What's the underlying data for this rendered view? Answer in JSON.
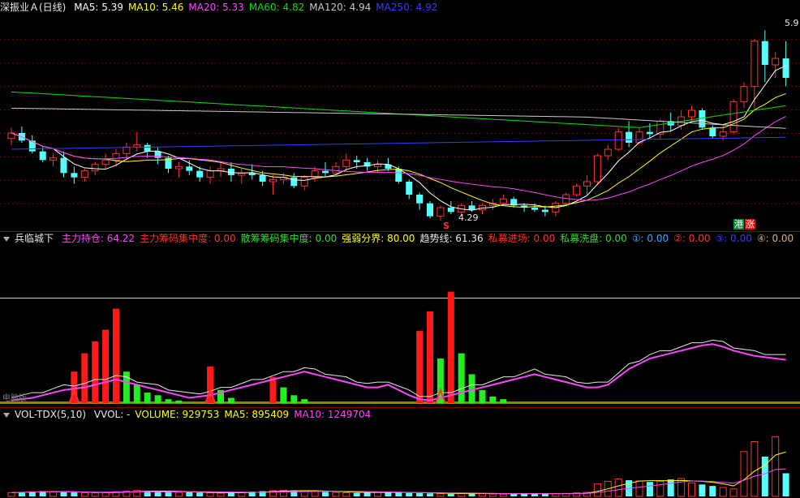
{
  "main": {
    "title": "深振业Ａ(日线)",
    "ma": [
      {
        "label": "MA5: 5.39",
        "color": "#ffffff"
      },
      {
        "label": "MA10: 5.46",
        "color": "#ffff00"
      },
      {
        "label": "MA20: 5.33",
        "color": "#ff44ff"
      },
      {
        "label": "MA60: 4.82",
        "color": "#00e000"
      },
      {
        "label": "MA120: 4.94",
        "color": "#c8c8c8"
      },
      {
        "label": "MA250: 4.92",
        "color": "#3a3aff"
      }
    ],
    "high_label": "5.9",
    "low_label": "4.29",
    "signal_s": "S",
    "badge_left": "港",
    "badge_right": "涨"
  },
  "indicator": {
    "name": "兵临城下",
    "items": [
      {
        "label": "主力持仓: 64.22",
        "color": "#ff44ff"
      },
      {
        "label": "主力筹码集中度: 0.00",
        "color": "#ff3030"
      },
      {
        "label": "散筹筹码集中度: 0.00",
        "color": "#33dd33"
      },
      {
        "label": "强弱分界: 80.00",
        "color": "#ffff00"
      },
      {
        "label": "趋势线: 61.36",
        "color": "#e8e8e8"
      },
      {
        "label": "私募进场: 0.00",
        "color": "#ff3030"
      },
      {
        "label": "私募洗盘: 0.00",
        "color": "#33dd33"
      },
      {
        "label": "①: 0.00",
        "color": "#33aaff"
      },
      {
        "label": "②: 0.00",
        "color": "#ff3030"
      },
      {
        "label": "③: 0.00",
        "color": "#3a3aff"
      },
      {
        "label": "④: 0.00",
        "color": "#d2b48c"
      }
    ],
    "corner_label": "电脑版"
  },
  "volume": {
    "name": "VOL-TDX(5,10)",
    "items": [
      {
        "label": "VVOL: -",
        "color": "#e8e8e8"
      },
      {
        "label": "VOLUME: 929753",
        "color": "#ffff00"
      },
      {
        "label": "MA5: 895409",
        "color": "#ffff00"
      },
      {
        "label": "MA10: 1249704",
        "color": "#ff44ff"
      }
    ]
  },
  "colors": {
    "up": "#ff3333",
    "down": "#54ffff",
    "grid": "#7a0000"
  },
  "chart_data": [
    {
      "type": "candlestick",
      "ylim": [
        4.1,
        6.05
      ],
      "ohlc": [
        [
          4.92,
          5.02,
          4.86,
          4.97
        ],
        [
          4.97,
          5.03,
          4.88,
          4.9
        ],
        [
          4.9,
          4.95,
          4.78,
          4.8
        ],
        [
          4.8,
          4.84,
          4.7,
          4.72
        ],
        [
          4.72,
          4.78,
          4.66,
          4.74
        ],
        [
          4.74,
          4.8,
          4.56,
          4.6
        ],
        [
          4.6,
          4.66,
          4.5,
          4.56
        ],
        [
          4.56,
          4.64,
          4.52,
          4.62
        ],
        [
          4.62,
          4.7,
          4.58,
          4.68
        ],
        [
          4.68,
          4.78,
          4.64,
          4.72
        ],
        [
          4.72,
          4.82,
          4.66,
          4.78
        ],
        [
          4.78,
          4.88,
          4.72,
          4.84
        ],
        [
          4.84,
          4.98,
          4.8,
          4.86
        ],
        [
          4.86,
          4.88,
          4.74,
          4.8
        ],
        [
          4.8,
          4.84,
          4.68,
          4.74
        ],
        [
          4.74,
          4.76,
          4.6,
          4.64
        ],
        [
          4.64,
          4.7,
          4.56,
          4.66
        ],
        [
          4.66,
          4.72,
          4.58,
          4.62
        ],
        [
          4.62,
          4.66,
          4.52,
          4.56
        ],
        [
          4.56,
          4.66,
          4.5,
          4.62
        ],
        [
          4.62,
          4.7,
          4.56,
          4.64
        ],
        [
          4.64,
          4.7,
          4.52,
          4.58
        ],
        [
          4.58,
          4.64,
          4.5,
          4.6
        ],
        [
          4.6,
          4.68,
          4.54,
          4.58
        ],
        [
          4.58,
          4.62,
          4.48,
          4.52
        ],
        [
          4.52,
          4.58,
          4.4,
          4.54
        ],
        [
          4.54,
          4.6,
          4.5,
          4.56
        ],
        [
          4.56,
          4.6,
          4.46,
          4.48
        ],
        [
          4.48,
          4.58,
          4.44,
          4.56
        ],
        [
          4.56,
          4.66,
          4.52,
          4.62
        ],
        [
          4.62,
          4.7,
          4.56,
          4.6
        ],
        [
          4.6,
          4.7,
          4.58,
          4.66
        ],
        [
          4.66,
          4.78,
          4.62,
          4.72
        ],
        [
          4.72,
          4.76,
          4.64,
          4.7
        ],
        [
          4.7,
          4.74,
          4.62,
          4.66
        ],
        [
          4.66,
          4.72,
          4.6,
          4.68
        ],
        [
          4.68,
          4.74,
          4.62,
          4.64
        ],
        [
          4.64,
          4.66,
          4.5,
          4.52
        ],
        [
          4.52,
          4.54,
          4.36,
          4.4
        ],
        [
          4.4,
          4.42,
          4.26,
          4.32
        ],
        [
          4.32,
          4.34,
          4.18,
          4.2
        ],
        [
          4.2,
          4.3,
          4.16,
          4.28
        ],
        [
          4.28,
          4.34,
          4.22,
          4.24
        ],
        [
          4.24,
          4.32,
          4.2,
          4.3
        ],
        [
          4.3,
          4.34,
          4.24,
          4.26
        ],
        [
          4.26,
          4.32,
          4.22,
          4.3
        ],
        [
          4.3,
          4.36,
          4.26,
          4.32
        ],
        [
          4.32,
          4.4,
          4.3,
          4.36
        ],
        [
          4.36,
          4.38,
          4.28,
          4.3
        ],
        [
          4.3,
          4.32,
          4.24,
          4.28
        ],
        [
          4.28,
          4.32,
          4.24,
          4.26
        ],
        [
          4.26,
          4.3,
          4.2,
          4.24
        ],
        [
          4.24,
          4.34,
          4.2,
          4.32
        ],
        [
          4.32,
          4.42,
          4.3,
          4.4
        ],
        [
          4.4,
          4.5,
          4.38,
          4.48
        ],
        [
          4.48,
          4.58,
          4.4,
          4.52
        ],
        [
          4.52,
          4.78,
          4.5,
          4.76
        ],
        [
          4.76,
          4.86,
          4.72,
          4.82
        ],
        [
          4.82,
          5.02,
          4.8,
          4.98
        ],
        [
          4.98,
          5.08,
          4.84,
          4.88
        ],
        [
          4.88,
          5.02,
          4.86,
          4.98
        ],
        [
          4.98,
          5.06,
          4.92,
          4.96
        ],
        [
          4.96,
          5.1,
          4.92,
          5.08
        ],
        [
          5.08,
          5.16,
          4.98,
          5.04
        ],
        [
          5.04,
          5.18,
          5.0,
          5.12
        ],
        [
          5.12,
          5.22,
          5.08,
          5.18
        ],
        [
          5.18,
          5.2,
          5.0,
          5.02
        ],
        [
          5.02,
          5.04,
          4.92,
          4.94
        ],
        [
          4.94,
          5.04,
          4.9,
          4.98
        ],
        [
          4.98,
          5.28,
          4.96,
          5.26
        ],
        [
          5.26,
          5.44,
          5.2,
          5.4
        ],
        [
          5.4,
          5.84,
          5.2,
          5.82
        ],
        [
          5.82,
          5.92,
          5.44,
          5.6
        ],
        [
          5.6,
          5.72,
          5.48,
          5.66
        ],
        [
          5.66,
          5.82,
          5.4,
          5.48
        ]
      ],
      "ma_values": {
        "MA5": 5.39,
        "MA10": 5.46,
        "MA20": 5.33,
        "MA60": 4.82,
        "MA120": 4.94,
        "MA250": 4.92
      }
    },
    {
      "type": "bar",
      "ylim": [
        0,
        120
      ],
      "series": [
        {
          "name": "主力持仓",
          "values": [
            2,
            3,
            4,
            6,
            8,
            10,
            11,
            12,
            14,
            16,
            18,
            16,
            14,
            12,
            10,
            8,
            6,
            4,
            5,
            6,
            8,
            10,
            12,
            14,
            16,
            18,
            20,
            22,
            24,
            22,
            20,
            18,
            16,
            14,
            12,
            12,
            14,
            10,
            6,
            3,
            2,
            4,
            6,
            8,
            10,
            12,
            14,
            16,
            18,
            20,
            22,
            20,
            18,
            16,
            14,
            12,
            12,
            14,
            20,
            26,
            30,
            34,
            36,
            38,
            40,
            42,
            44,
            45,
            43,
            40,
            38,
            36,
            35,
            34,
            33
          ]
        },
        {
          "name": "私募进场",
          "values": [
            0,
            0,
            0,
            0,
            0,
            0,
            24,
            38,
            47,
            56,
            72,
            0,
            0,
            0,
            0,
            0,
            0,
            0,
            0,
            0,
            0,
            0,
            0,
            0,
            0,
            0,
            0,
            0,
            0,
            0,
            0,
            0,
            0,
            0,
            0,
            0,
            0,
            0,
            0,
            0,
            0,
            0,
            0,
            0,
            0,
            0,
            0,
            0,
            0,
            0,
            0,
            0,
            0,
            0,
            0,
            0,
            0,
            0,
            0,
            0,
            0,
            0,
            0,
            0,
            0,
            0,
            0,
            0,
            0,
            0,
            0,
            0,
            0,
            0,
            0
          ]
        },
        {
          "name": "私募洗盘",
          "values": [
            0,
            0,
            0,
            0,
            0,
            0,
            0,
            0,
            0,
            0,
            0,
            24,
            14,
            8,
            6,
            3,
            2,
            0,
            0,
            0,
            0,
            0,
            0,
            0,
            0,
            0,
            0,
            0,
            0,
            0,
            0,
            0,
            0,
            0,
            0,
            0,
            0,
            0,
            0,
            0,
            0,
            0,
            0,
            0,
            0,
            0,
            0,
            0,
            0,
            0,
            0,
            0,
            0,
            0,
            0,
            0,
            0,
            0,
            0,
            0,
            0,
            0,
            0,
            0,
            0,
            0,
            0,
            0,
            0,
            0,
            0,
            0,
            0,
            0,
            0
          ]
        }
      ],
      "强弱分界": 80.0,
      "趋势线": 61.36,
      "主力持仓": 64.22
    },
    {
      "type": "bar",
      "ylim": [
        0,
        3000000
      ],
      "values": [
        150000,
        180000,
        200000,
        210000,
        190000,
        170000,
        160000,
        150000,
        140000,
        160000,
        190000,
        210000,
        240000,
        220000,
        200000,
        180000,
        160000,
        170000,
        150000,
        140000,
        130000,
        150000,
        170000,
        190000,
        210000,
        230000,
        250000,
        240000,
        220000,
        200000,
        180000,
        160000,
        150000,
        140000,
        160000,
        180000,
        170000,
        150000,
        140000,
        130000,
        120000,
        110000,
        100000,
        120000,
        130000,
        110000,
        100000,
        90000,
        110000,
        120000,
        130000,
        110000,
        100000,
        120000,
        140000,
        160000,
        500000,
        600000,
        700000,
        650000,
        620000,
        580000,
        600000,
        680000,
        720000,
        540000,
        480000,
        420000,
        360000,
        300000,
        1800000,
        2200000,
        1600000,
        2400000,
        929753
      ],
      "MA5": 895409,
      "MA10": 1249704
    }
  ]
}
